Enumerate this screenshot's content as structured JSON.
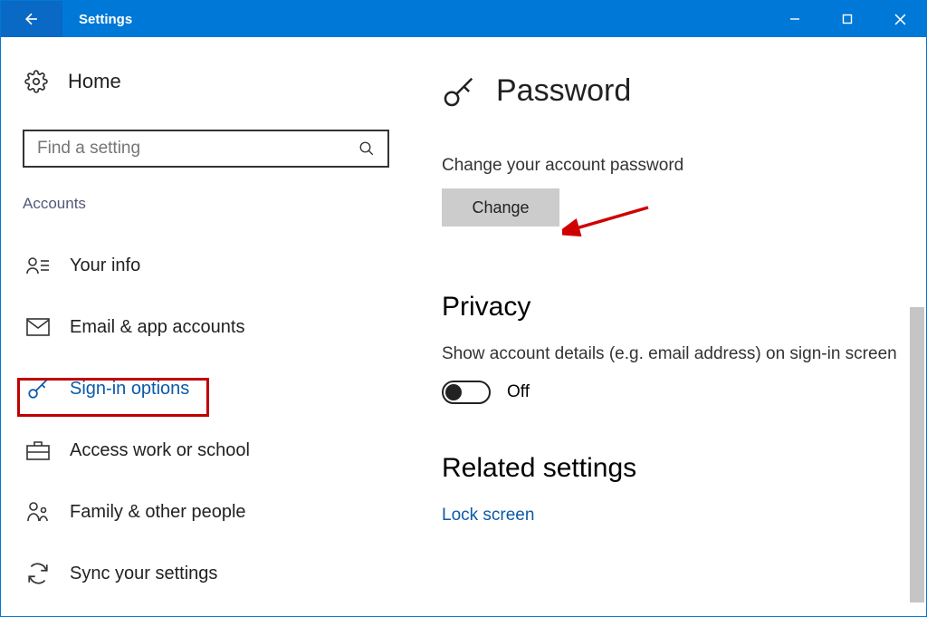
{
  "titlebar": {
    "title": "Settings"
  },
  "sidebar": {
    "home": "Home",
    "search_placeholder": "Find a setting",
    "section": "Accounts",
    "items": [
      {
        "label": "Your info"
      },
      {
        "label": "Email & app accounts"
      },
      {
        "label": "Sign-in options"
      },
      {
        "label": "Access work or school"
      },
      {
        "label": "Family & other people"
      },
      {
        "label": "Sync your settings"
      }
    ]
  },
  "content": {
    "password_title": "Password",
    "password_desc": "Change your account password",
    "change_button": "Change",
    "privacy_title": "Privacy",
    "privacy_desc": "Show account details (e.g. email address) on sign-in screen",
    "privacy_toggle_label": "Off",
    "related_title": "Related settings",
    "related_link": "Lock screen"
  },
  "colors": {
    "accent": "#0078d7",
    "highlight": "#c00000",
    "link": "#0b5aa8"
  }
}
